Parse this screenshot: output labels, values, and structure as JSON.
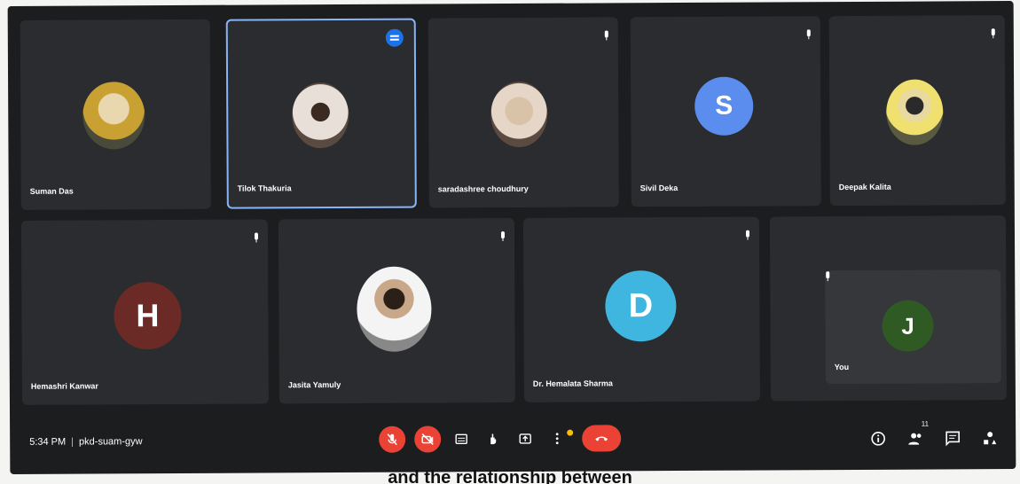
{
  "meeting": {
    "time": "5:34 PM",
    "code": "pkd-suam-gyw"
  },
  "participants_row1": [
    {
      "name": "Suman Das",
      "avatar": "photo",
      "muted": false
    },
    {
      "name": "Tilok Thakuria",
      "avatar": "photo",
      "muted": false,
      "active_speaker": true
    },
    {
      "name": "saradashree choudhury",
      "avatar": "photo",
      "muted": true
    },
    {
      "name": "Sivil Deka",
      "avatar": "S",
      "avatar_color": "#5b8def",
      "muted": true
    },
    {
      "name": "Deepak Kalita",
      "avatar": "photo",
      "muted": true
    }
  ],
  "participants_row2": [
    {
      "name": "Hemashri Kanwar",
      "avatar": "H",
      "avatar_color": "#6b2a25",
      "muted": true
    },
    {
      "name": "Jasita Yamuly",
      "avatar": "photo",
      "muted": true
    },
    {
      "name": "Dr. Hemalata Sharma",
      "avatar": "D",
      "avatar_color": "#3fb6e0",
      "muted": true
    }
  ],
  "self_view": {
    "name": "You",
    "avatar": "J",
    "avatar_color": "#2f5a24",
    "muted": true
  },
  "controls": [
    "mic-off-icon",
    "camera-off-icon",
    "captions-icon",
    "raise-hand-icon",
    "present-icon",
    "more-options-icon",
    "end-call-icon"
  ],
  "right_controls": [
    "info-icon",
    "people-icon",
    "chat-icon",
    "activities-icon"
  ],
  "people_count": "11",
  "caption_text": "and the relationship between",
  "colors": {
    "accent": "#8ab4f8",
    "danger": "#ea4335",
    "tile": "#2a2c2f",
    "background": "#1b1d1f"
  }
}
